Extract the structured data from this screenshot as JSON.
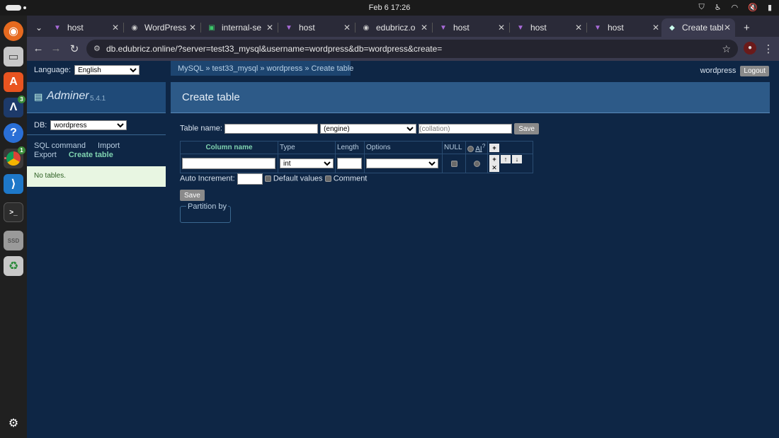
{
  "system": {
    "clock": "Feb 6  17:26"
  },
  "tabs": [
    {
      "label": "host",
      "favicon": "▼"
    },
    {
      "label": "WordPress",
      "favicon": "◉"
    },
    {
      "label": "internal-se",
      "favicon": "▣"
    },
    {
      "label": "host",
      "favicon": "▼"
    },
    {
      "label": "edubricz.o",
      "favicon": "◉"
    },
    {
      "label": "host",
      "favicon": "▼"
    },
    {
      "label": "host",
      "favicon": "▼"
    },
    {
      "label": "host",
      "favicon": "▼"
    },
    {
      "label": "Create tabl",
      "favicon": "◆"
    }
  ],
  "url": "db.edubricz.online/?server=test33_mysql&username=wordpress&db=wordpress&create=",
  "language": {
    "label": "Language:",
    "value": "English"
  },
  "logo": {
    "name": "Adminer",
    "version": "5.4.1"
  },
  "db": {
    "label": "DB:",
    "value": "wordpress"
  },
  "links": {
    "sql_command": "SQL command",
    "import": "Import",
    "export": "Export",
    "create_table": "Create table"
  },
  "no_tables": "No tables.",
  "breadcrumb": "MySQL » test33_mysql » wordpress » Create table",
  "user": {
    "name": "wordpress",
    "logout": "Logout"
  },
  "title": "Create table",
  "form": {
    "table_name_label": "Table name:",
    "engine": "(engine)",
    "collation_placeholder": "(collation)",
    "save": "Save",
    "headers": {
      "column_name": "Column name",
      "type": "Type",
      "length": "Length",
      "options": "Options",
      "null": "NULL",
      "ai": "AI"
    },
    "ai_sup": "?",
    "type_value": "int",
    "auto_increment_label": "Auto Increment:",
    "default_values": "Default values",
    "comment": "Comment",
    "partition_by": "Partition by"
  }
}
